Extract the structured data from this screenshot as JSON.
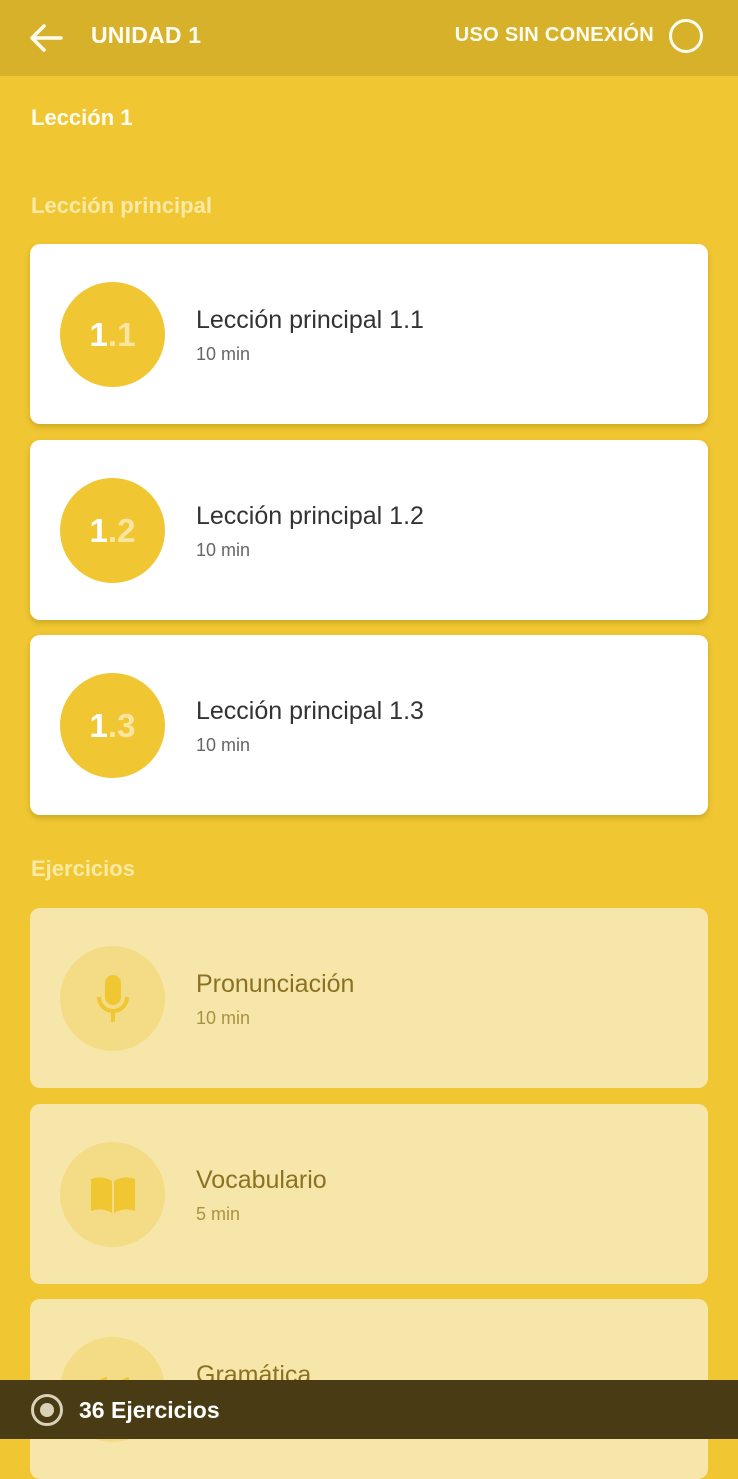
{
  "header": {
    "title": "UNIDAD 1",
    "offline_label": "USO SIN CONEXIÓN",
    "back_icon": "arrow-left-icon",
    "toggle_icon": "circle-toggle-icon"
  },
  "lesson": {
    "title": "Lección 1"
  },
  "main_section": {
    "title": "Lección principal",
    "items": [
      {
        "badge_main": "1",
        "badge_dot": ".",
        "badge_sub": "1",
        "title": "Lección principal 1.1",
        "duration": "10 min"
      },
      {
        "badge_main": "1",
        "badge_dot": ".",
        "badge_sub": "2",
        "title": "Lección principal 1.2",
        "duration": "10 min"
      },
      {
        "badge_main": "1",
        "badge_dot": ".",
        "badge_sub": "3",
        "title": "Lección principal 1.3",
        "duration": "10 min"
      }
    ]
  },
  "exercises_section": {
    "title": "Ejercicios",
    "items": [
      {
        "icon": "microphone-icon",
        "title": "Pronunciación",
        "duration": "10 min"
      },
      {
        "icon": "book-icon",
        "title": "Vocabulario",
        "duration": "5 min"
      },
      {
        "icon": "quote-icon",
        "title": "Gramática",
        "duration": ""
      }
    ]
  },
  "footer": {
    "label": "36 Ejercicios",
    "icon": "target-icon"
  },
  "colors": {
    "background": "#f0c732",
    "topbar": "#d8b12b",
    "card": "#ffffff",
    "locked_card": "#f7e6a9",
    "bottom_bar": "#493c14"
  }
}
